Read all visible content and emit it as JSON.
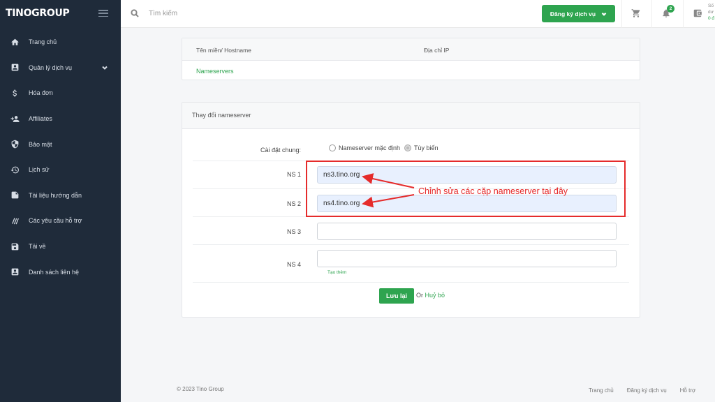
{
  "brand": {
    "logo": "TINOGROUP"
  },
  "sidebar": {
    "items": [
      {
        "label": "Trang chủ",
        "icon": "home-icon"
      },
      {
        "label": "Quản lý dịch vụ",
        "icon": "account-box-icon",
        "has_submenu": true
      },
      {
        "label": "Hóa đơn",
        "icon": "dollar-icon"
      },
      {
        "label": "Affiliates",
        "icon": "add-user-icon"
      },
      {
        "label": "Bảo mật",
        "icon": "shield-icon"
      },
      {
        "label": "Lịch sử",
        "icon": "history-icon"
      },
      {
        "label": "Tài liệu hướng dẫn",
        "icon": "document-icon"
      },
      {
        "label": "Các yêu cầu hỗ trợ",
        "icon": "ticket-icon"
      },
      {
        "label": "Tải về",
        "icon": "save-icon"
      },
      {
        "label": "Danh sách liên hệ",
        "icon": "contact-icon"
      }
    ]
  },
  "topbar": {
    "search_placeholder": "Tìm kiếm",
    "register_label": "Đăng ký dịch vụ",
    "notification_count": "2",
    "wallet_line1": "Số",
    "wallet_line2": "dư",
    "wallet_line3": "0 đ"
  },
  "hostname_card": {
    "col_hostname": "Tên miền/ Hostname",
    "col_ip": "Địa chỉ IP",
    "nameservers_link": "Nameservers"
  },
  "ns_form": {
    "title": "Thay đổi nameserver",
    "general_label": "Cài đặt chung:",
    "option_default": "Nameserver mặc định",
    "option_custom": "Tùy biến",
    "selected_option": "custom",
    "fields": [
      {
        "label": "NS 1",
        "value": "ns3.tino.org"
      },
      {
        "label": "NS 2",
        "value": "ns4.tino.org"
      },
      {
        "label": "NS 3",
        "value": ""
      },
      {
        "label": "NS 4",
        "value": ""
      }
    ],
    "add_more": "Tạo thêm",
    "save_label": "Lưu lại",
    "or_text": "Or",
    "cancel_label": "Huỷ bỏ"
  },
  "annotation": {
    "text": "Chỉnh sửa các cặp nameserver tại đây",
    "color": "#e52b2b"
  },
  "footer": {
    "copyright": "© 2023 Tino Group",
    "links": [
      "Trang chủ",
      "Đăng ký dịch vụ",
      "Hỗ trợ"
    ]
  },
  "colors": {
    "accent": "#2ea44f",
    "sidebar_bg": "#1f2b3a"
  }
}
